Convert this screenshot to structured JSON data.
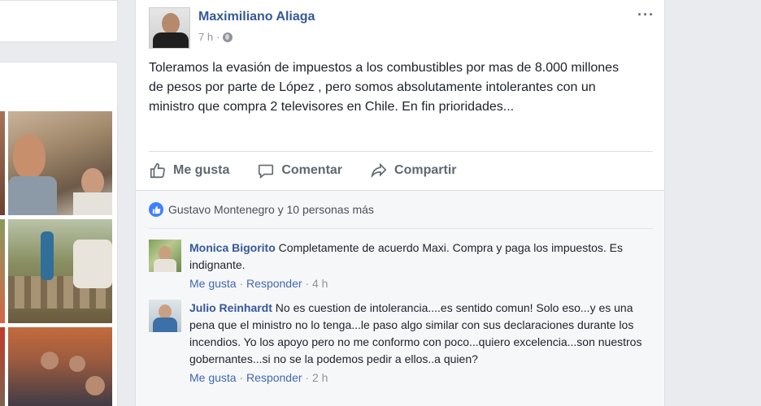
{
  "post": {
    "author": "Maximiliano Aliaga",
    "time": "7 h",
    "more": "···",
    "text": "Toleramos la evasión de impuestos a los combustibles por mas de 8.000 millones de pesos por parte de López , pero somos absolutamente intolerantes con un ministro que compra 2 televisores en Chile. En fin prioridades...",
    "actions": {
      "like": "Me gusta",
      "comment": "Comentar",
      "share": "Compartir"
    },
    "likes_summary": "Gustavo Montenegro y 10 personas más"
  },
  "comments": [
    {
      "name": "Monica Bigorito",
      "text": "Completamente de acuerdo Maxi. Compra y paga los impuestos. Es indignante.",
      "like": "Me gusta",
      "reply": "Responder",
      "time": "4 h"
    },
    {
      "name": "Julio Reinhardt",
      "text": "No es cuestion de intolerancia....es sentido comun! Solo eso...y es una pena que el ministro no lo tenga...le paso algo similar con sus declaraciones durante los incendios. Yo los apoyo pero no me conformo con poco...quiero excelencia...son nuestros gobernantes...si no se la podemos pedir a ellos..a quien?",
      "like": "Me gusta",
      "reply": "Responder",
      "time": "2 h"
    }
  ],
  "separator": "·",
  "colors": {
    "link": "#365899",
    "action_link": "#4267b2",
    "muted": "#90949c",
    "like_blue": "#4080ff",
    "background": "#e9ebee"
  }
}
